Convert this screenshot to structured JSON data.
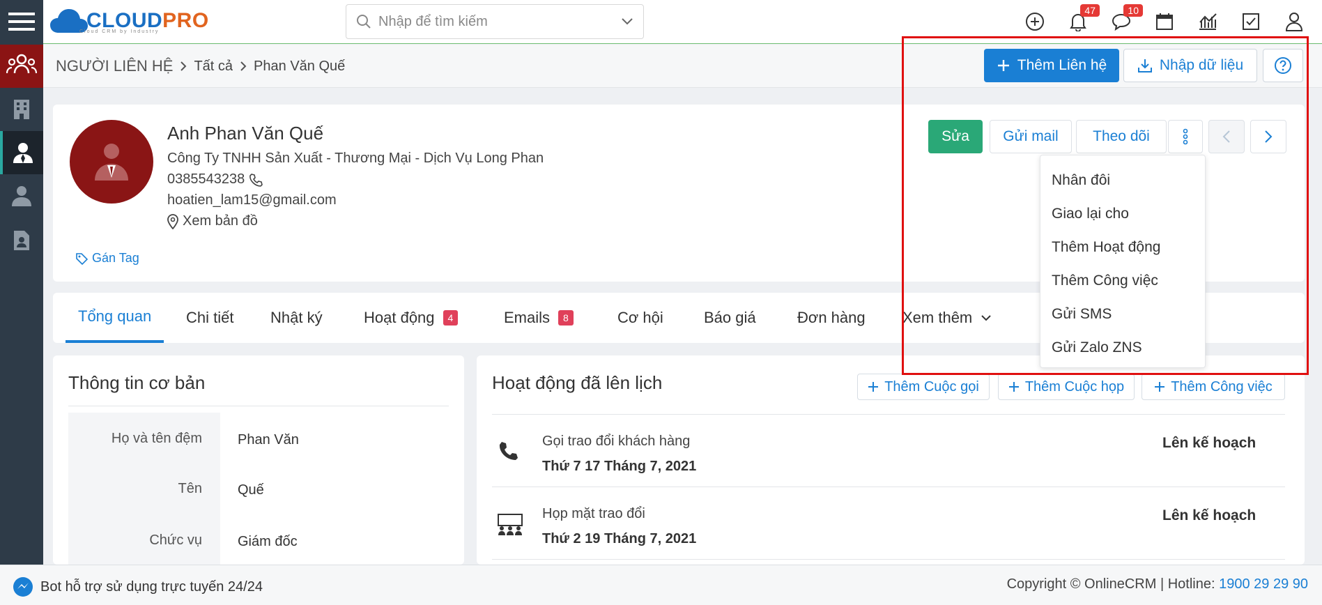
{
  "header": {
    "logo_main": "CLOUD",
    "logo_accent": "PRO",
    "logo_sub": "Cloud CRM by Industry",
    "search_placeholder": "Nhập để tìm kiếm",
    "notifications_count": "47",
    "messages_count": "10"
  },
  "breadcrumb": {
    "root": "NGƯỜI LIÊN HỆ",
    "level1": "Tất cả",
    "level2": "Phan Văn Quế"
  },
  "toolbar": {
    "add_contact": "Thêm Liên hệ",
    "import": "Nhập dữ liệu"
  },
  "profile": {
    "name": "Anh Phan Văn Quế",
    "company": "Công Ty TNHH Sản Xuất - Thương Mại - Dịch Vụ Long Phan",
    "phone": "0385543238",
    "email": "hoatien_lam15@gmail.com",
    "map": "Xem bản đồ",
    "tag": "Gán Tag",
    "edit": "Sửa",
    "send_mail": "Gửi mail",
    "follow": "Theo dõi"
  },
  "more_menu": {
    "items": [
      "Nhân đôi",
      "Giao lại cho",
      "Thêm Hoạt động",
      "Thêm Công việc",
      "Gửi SMS",
      "Gửi Zalo ZNS"
    ]
  },
  "tabs": {
    "overview": "Tổng quan",
    "detail": "Chi tiết",
    "log": "Nhật ký",
    "activity": "Hoạt động",
    "activity_count": "4",
    "emails": "Emails",
    "emails_count": "8",
    "opportunity": "Cơ hội",
    "quote": "Báo giá",
    "order": "Đơn hàng",
    "more": "Xem thêm"
  },
  "basic_info": {
    "title": "Thông tin cơ bản",
    "rows": [
      {
        "label": "Họ và tên đệm",
        "value": "Phan Văn"
      },
      {
        "label": "Tên",
        "value": "Quế"
      },
      {
        "label": "Chức vụ",
        "value": "Giám đốc"
      }
    ]
  },
  "scheduled": {
    "title": "Hoạt động đã lên lịch",
    "add_call": "Thêm Cuộc gọi",
    "add_meeting": "Thêm Cuộc họp",
    "add_task": "Thêm Công việc",
    "items": [
      {
        "title": "Gọi trao đổi khách hàng",
        "date": "Thứ 7 17 Tháng 7, 2021",
        "status": "Lên kế hoạch"
      },
      {
        "title": "Họp mặt trao đổi",
        "date": "Thứ 2 19 Tháng 7, 2021",
        "status": "Lên kế hoạch"
      }
    ]
  },
  "footer": {
    "bot": "Bot hỗ trợ sử dụng trực tuyến 24/24",
    "copyright": "Copyright © OnlineCRM",
    "hotline_label": "Hotline: ",
    "hotline": "1900 29 29 90"
  }
}
